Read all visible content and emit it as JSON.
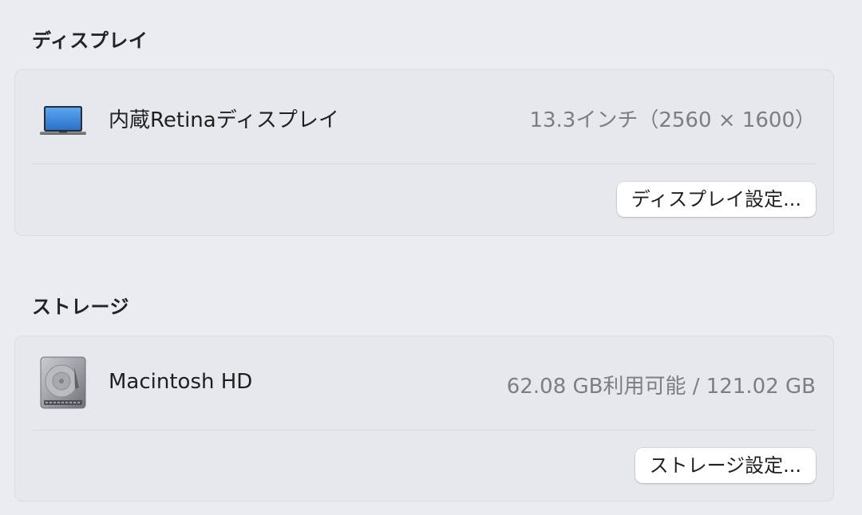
{
  "display_section": {
    "title": "ディスプレイ",
    "item": {
      "name": "内蔵Retinaディスプレイ",
      "value": "13.3インチ（2560 × 1600）",
      "icon": "laptop-icon"
    },
    "button_label": "ディスプレイ設定..."
  },
  "storage_section": {
    "title": "ストレージ",
    "item": {
      "name": "Macintosh HD",
      "value": "62.08 GB利用可能 / 121.02 GB",
      "icon": "hard-drive-icon"
    },
    "button_label": "ストレージ設定..."
  },
  "colors": {
    "background": "#e9ecf0",
    "card": "#e5e8ec",
    "secondary_text": "#7b7e84",
    "button": "#ffffff"
  }
}
